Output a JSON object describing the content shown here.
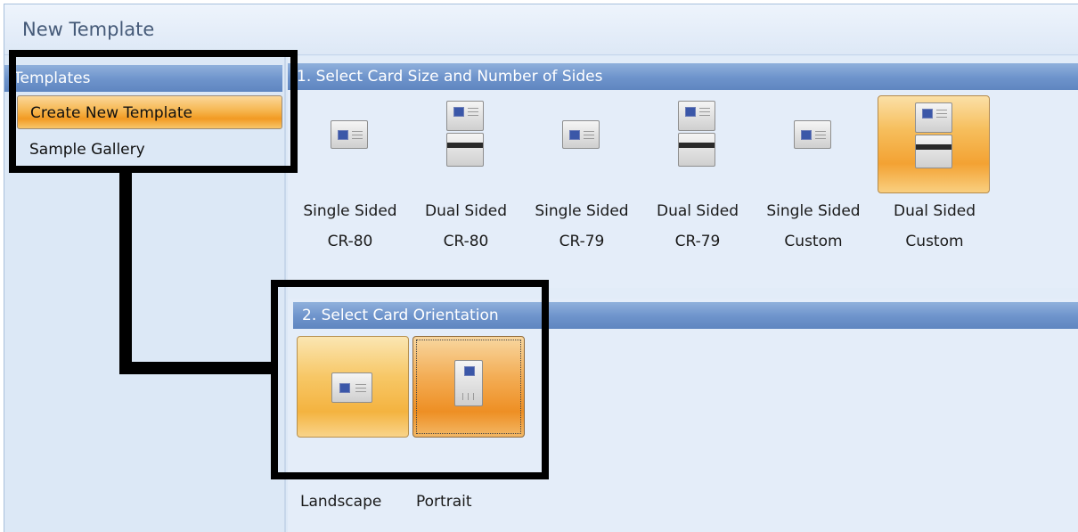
{
  "window": {
    "title": "New Template"
  },
  "sidebar": {
    "header": "Templates",
    "items": [
      {
        "label": "Create New Template",
        "selected": true
      },
      {
        "label": "Sample Gallery",
        "selected": false
      }
    ]
  },
  "section1": {
    "header": "1. Select Card Size and Number of Sides",
    "options": [
      {
        "line1": "Single Sided",
        "line2": "CR-80",
        "sides": "single",
        "selected": false
      },
      {
        "line1": "Dual Sided",
        "line2": "CR-80",
        "sides": "dual",
        "selected": false
      },
      {
        "line1": "Single Sided",
        "line2": "CR-79",
        "sides": "single",
        "selected": false
      },
      {
        "line1": "Dual Sided",
        "line2": "CR-79",
        "sides": "dual",
        "selected": false
      },
      {
        "line1": "Single Sided",
        "line2": "Custom",
        "sides": "single",
        "selected": false
      },
      {
        "line1": "Dual Sided",
        "line2": "Custom",
        "sides": "dual",
        "selected": true
      }
    ]
  },
  "section2": {
    "header": "2. Select Card Orientation",
    "options": [
      {
        "label": "Landscape",
        "icon": "landscape-card-icon"
      },
      {
        "label": "Portrait",
        "icon": "portrait-card-icon",
        "focused": true
      }
    ]
  },
  "colors": {
    "header_blue": "#6d93cb",
    "selection_orange": "#f29a23",
    "callout": "#000000"
  }
}
